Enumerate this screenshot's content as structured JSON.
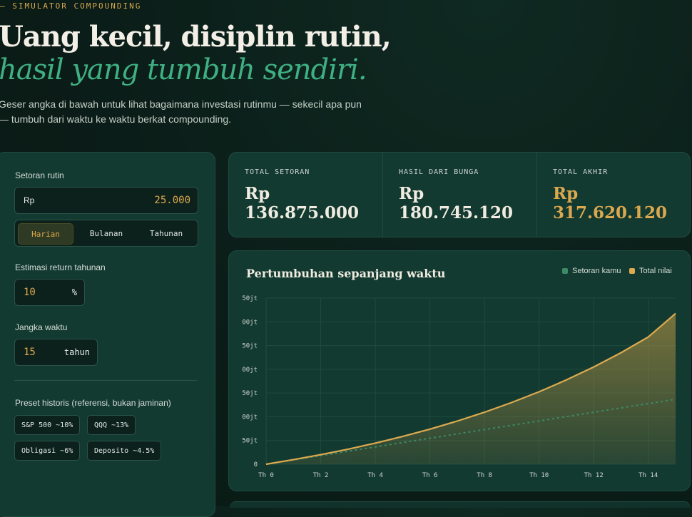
{
  "header": {
    "eyebrow": "— SIMULATOR COMPOUNDING",
    "title_line1": "Uang kecil, disiplin rutin,",
    "title_line2": "hasil yang tumbuh sendiri.",
    "lead": "Geser angka di bawah untuk lihat bagaimana investasi rutinmu — sekecil apa pun — tumbuh dari waktu ke waktu berkat compounding."
  },
  "form": {
    "deposit_label": "Setoran rutin",
    "deposit_prefix": "Rp",
    "deposit_value": "25.000",
    "frequency_options": [
      "Harian",
      "Bulanan",
      "Tahunan"
    ],
    "frequency_selected": "Harian",
    "return_label": "Estimasi return tahunan",
    "return_value": "10",
    "return_unit": "%",
    "duration_label": "Jangka waktu",
    "duration_value": "15",
    "duration_unit": "tahun",
    "presets_label": "Preset historis (referensi, bukan jaminan)",
    "presets": [
      "S&P 500 ~10%",
      "QQQ ~13%",
      "Obligasi ~6%",
      "Deposito ~4.5%"
    ]
  },
  "stats": [
    {
      "caption": "TOTAL SETORAN",
      "value": "Rp 136.875.000"
    },
    {
      "caption": "HASIL DARI BUNGA",
      "value": "Rp 180.745.120"
    },
    {
      "caption": "TOTAL AKHIR",
      "value": "Rp 317.620.120"
    }
  ],
  "chart": {
    "title": "Pertumbuhan sepanjang waktu",
    "legend": [
      "Setoran kamu",
      "Total nilai"
    ],
    "colors": {
      "setoran": "#3c8a66",
      "total": "#dcaa4f",
      "accent": "#3fb083"
    },
    "yticks": [
      "50jt",
      "00jt",
      "50jt",
      "00jt",
      "50jt",
      "00jt",
      "50jt",
      "0"
    ],
    "xticks": [
      "Th 0",
      "Th 2",
      "Th 4",
      "Th 6",
      "Th 8",
      "Th 10",
      "Th 12",
      "Th 14"
    ]
  },
  "chart_data": {
    "type": "area",
    "title": "Pertumbuhan sepanjang waktu",
    "x": [
      0,
      1,
      2,
      3,
      4,
      5,
      6,
      7,
      8,
      9,
      10,
      11,
      12,
      13,
      14,
      15
    ],
    "ylim": [
      0,
      350000000
    ],
    "series": [
      {
        "name": "Setoran kamu",
        "values": [
          0,
          9125000,
          18250000,
          27375000,
          36500000,
          45625000,
          54750000,
          63875000,
          73000000,
          82125000,
          91250000,
          100375000,
          109500000,
          118625000,
          127750000,
          136875000
        ]
      },
      {
        "name": "Total nilai",
        "values": [
          0,
          9575000,
          20110000,
          31700000,
          44450000,
          58470000,
          73900000,
          90870000,
          109540000,
          130070000,
          152660000,
          177510000,
          204840000,
          234900000,
          267970000,
          317620120
        ]
      }
    ]
  }
}
